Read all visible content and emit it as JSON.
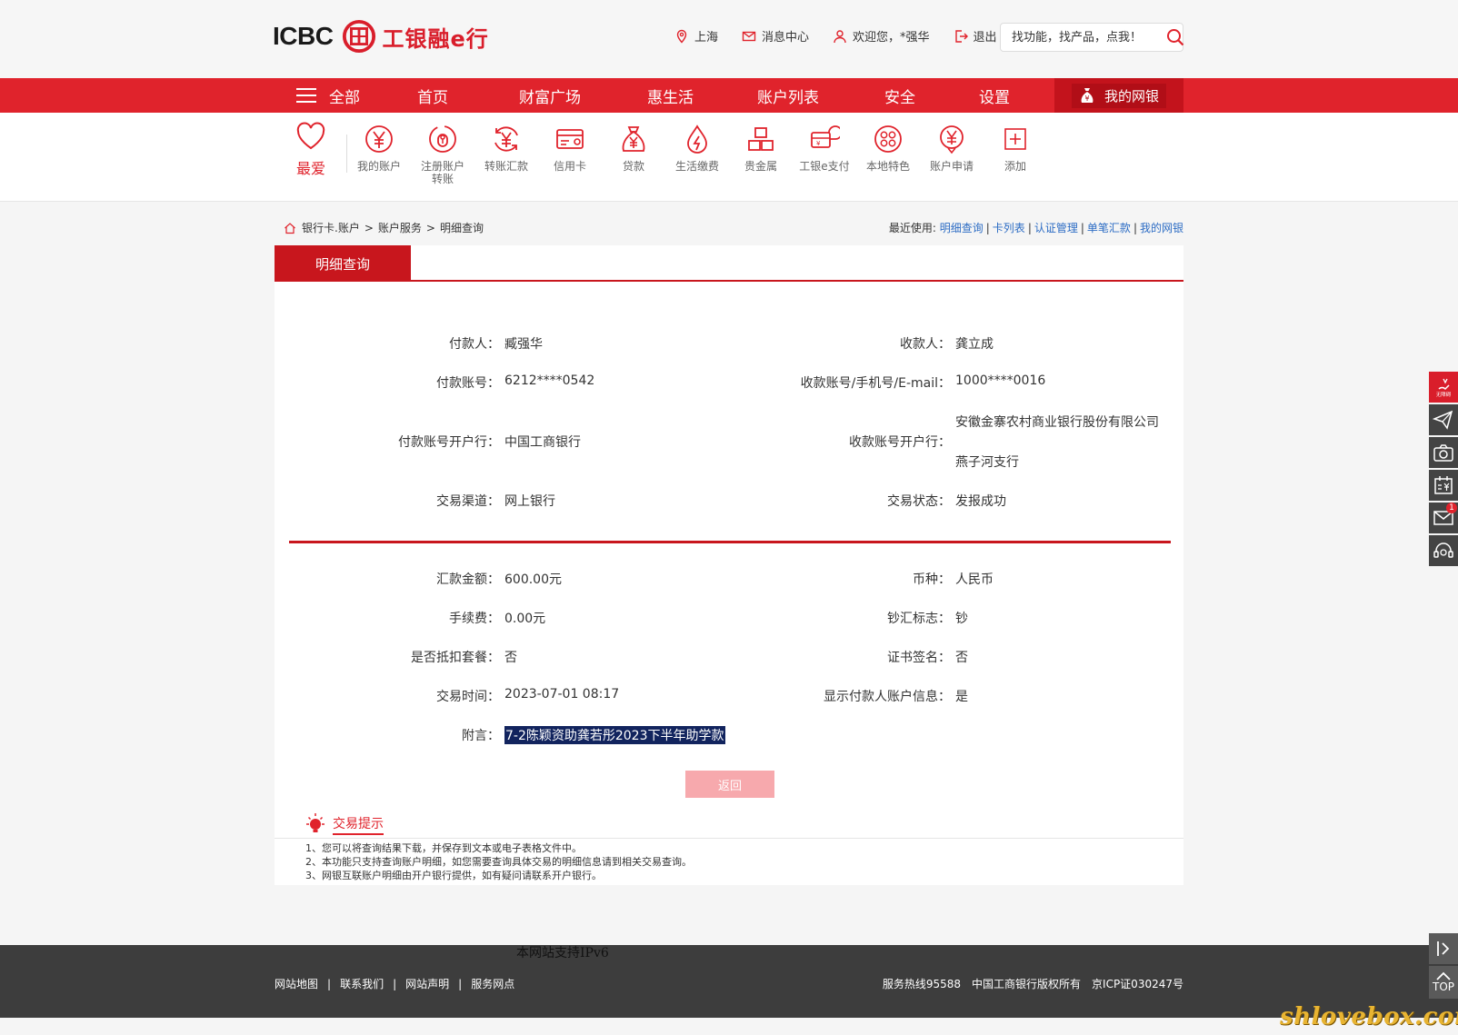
{
  "header": {
    "logo_icbc": "ICBC",
    "logo_cn": "工银融e行",
    "links": [
      {
        "icon": "location-icon",
        "label": "上海"
      },
      {
        "icon": "mail-icon",
        "label": "消息中心"
      },
      {
        "icon": "user-icon",
        "label": "欢迎您，*强华"
      },
      {
        "icon": "logout-icon",
        "label": "退出"
      }
    ],
    "search_placeholder": "找功能，找产品，点我！"
  },
  "nav": {
    "items": [
      "全部",
      "首页",
      "财富广场",
      "惠生活",
      "账户列表",
      "安全",
      "设置"
    ],
    "mybank": "我的网银"
  },
  "functions": {
    "favorite": "最爱",
    "items": [
      {
        "icon": "yen-account-icon",
        "label": "我的账户"
      },
      {
        "icon": "register-account-icon",
        "label": "注册账户转账"
      },
      {
        "icon": "transfer-icon",
        "label": "转账汇款"
      },
      {
        "icon": "credit-card-icon",
        "label": "信用卡"
      },
      {
        "icon": "loan-bag-icon",
        "label": "贷款"
      },
      {
        "icon": "utility-drop-icon",
        "label": "生活缴费"
      },
      {
        "icon": "gold-bars-icon",
        "label": "贵金属"
      },
      {
        "icon": "epay-icon",
        "label": "工银e支付"
      },
      {
        "icon": "local-feature-icon",
        "label": "本地特色"
      },
      {
        "icon": "account-apply-icon",
        "label": "账户申请"
      },
      {
        "icon": "add-icon",
        "label": "添加"
      }
    ]
  },
  "breadcrumb": {
    "items": [
      "银行卡.账户",
      "账户服务",
      "明细查询"
    ],
    "separator": ">"
  },
  "recent": {
    "label": "最近使用:",
    "links": [
      "明细查询",
      "卡列表",
      "认证管理",
      "单笔汇款",
      "我的网银"
    ]
  },
  "panel": {
    "tab": "明细查询",
    "fields": {
      "payer_label": "付款人：",
      "payer": "臧强华",
      "payee_label": "收款人：",
      "payee": "龚立成",
      "payer_acct_label": "付款账号：",
      "payer_acct": "6212****0542",
      "payee_acct_label": "收款账号/手机号/E-mail：",
      "payee_acct": "1000****0016",
      "payer_bank_label": "付款账号开户行：",
      "payer_bank": "中国工商银行",
      "payee_bank_label": "收款账号开户行：",
      "payee_bank_1": "安徽金寨农村商业银行股份有限公司",
      "payee_bank_2": "燕子河支行",
      "channel_label": "交易渠道：",
      "channel": "网上银行",
      "status_label": "交易状态：",
      "status": "发报成功",
      "amount_label": "汇款金额：",
      "amount": "600.00元",
      "currency_label": "币种：",
      "currency": "人民币",
      "fee_label": "手续费：",
      "fee": "0.00元",
      "cash_label": "钞汇标志：",
      "cash": "钞",
      "package_label": "是否抵扣套餐：",
      "package": "否",
      "cert_label": "证书签名：",
      "cert": "否",
      "time_label": "交易时间：",
      "time": "2023-07-01 08:17",
      "show_payer_label": "显示付款人账户信息：",
      "show_payer": "是",
      "memo_label": "附言：",
      "memo": "7-2陈颖资助龚若彤2023下半年助学款"
    },
    "back_button": "返回"
  },
  "tips": {
    "title": "交易提示",
    "items": [
      "1、您可以将查询结果下载，并保存到文本或电子表格文件中。",
      "2、本功能只支持查询账户明细，如您需要查询具体交易的明细信息请到相关交易查询。",
      "3、网银互联账户明细由开户银行提供，如有疑问请联系开户银行。"
    ]
  },
  "footer": {
    "ipv6": "本网站支持IPv6",
    "links": [
      "网站地图",
      "联系我们",
      "网站声明",
      "服务网点"
    ],
    "hotline": "服务热线95588",
    "copyright": "中国工商银行版权所有",
    "icp": "京ICP证030247号"
  },
  "sidetools": {
    "top_label": "TOP",
    "mail_badge": "1",
    "first_tool_label": "无障碍"
  },
  "watermark": "shlovebox.com",
  "colors": {
    "brand_red": "#e0232c",
    "dark_red": "#c8161d",
    "link_blue": "#2c6cc4",
    "footer_bg": "#3d3d3d"
  }
}
